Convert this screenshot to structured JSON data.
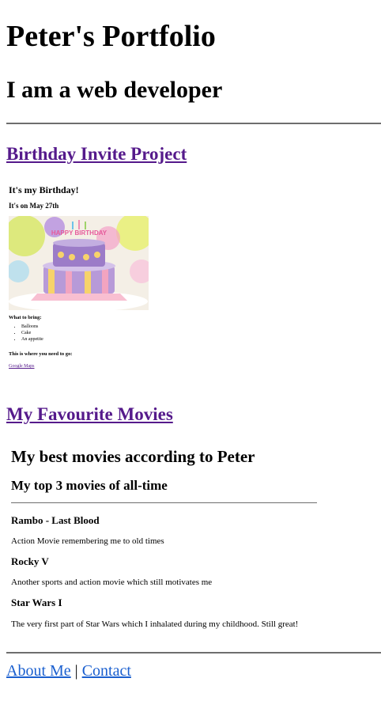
{
  "header": {
    "title": "Peter's Portfolio",
    "subtitle": "I am a web developer"
  },
  "projects": {
    "birthday": {
      "link": "Birthday Invite Project",
      "heading": "It's my Birthday!",
      "date": "It's on May 27th",
      "bring_heading": "What to bring:",
      "items": [
        "Balloons",
        "Cake",
        "An appetite"
      ],
      "where_heading": "This is where you need to go:",
      "map_link": "Google Maps",
      "cake_text": "HAPPY BIRTHDAY"
    },
    "movies": {
      "link": "My Favourite Movies",
      "heading": "My best movies according to Peter",
      "subheading": "My top 3 movies of all-time",
      "list": [
        {
          "title": "Rambo - Last Blood",
          "desc": "Action Movie remembering me to old times"
        },
        {
          "title": "Rocky V",
          "desc": "Another sports and action movie which still motivates me"
        },
        {
          "title": "Star Wars I",
          "desc": "The very first part of Star Wars which I inhalated during my childhood. Still great!"
        }
      ]
    }
  },
  "footer": {
    "about": "About Me",
    "separator": "|",
    "contact": "Contact"
  },
  "colors": {
    "visited_link": "#551a8b",
    "link": "#1a5fcf",
    "rule": "#6e6e6e"
  }
}
